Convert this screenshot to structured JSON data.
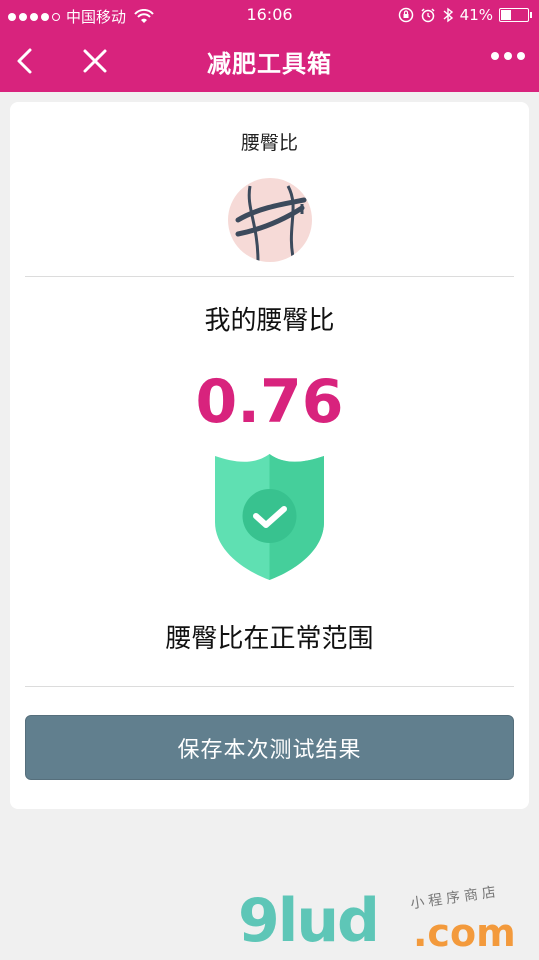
{
  "status_bar": {
    "carrier": "中国移动",
    "time": "16:06",
    "battery": "41%",
    "battery_level": 0.41
  },
  "nav": {
    "title": "减肥工具箱"
  },
  "card": {
    "tool_title": "腰臀比",
    "result_label": "我的腰臀比",
    "result_value": "0.76",
    "status_text": "腰臀比在正常范围",
    "save_button": "保存本次测试结果"
  },
  "watermark": {
    "main": "9lud",
    "dotcom": ".com",
    "sub": "小程序商店"
  },
  "colors": {
    "brand": "#d8237d",
    "button": "#617f8e",
    "shield": "#43d39e"
  },
  "icons": [
    "back-arrow-icon",
    "close-icon",
    "more-dots-icon",
    "wifi-icon",
    "lock-rotation-icon",
    "alarm-icon",
    "bluetooth-icon",
    "battery-icon",
    "waist-measure-icon",
    "shield-check-icon"
  ]
}
